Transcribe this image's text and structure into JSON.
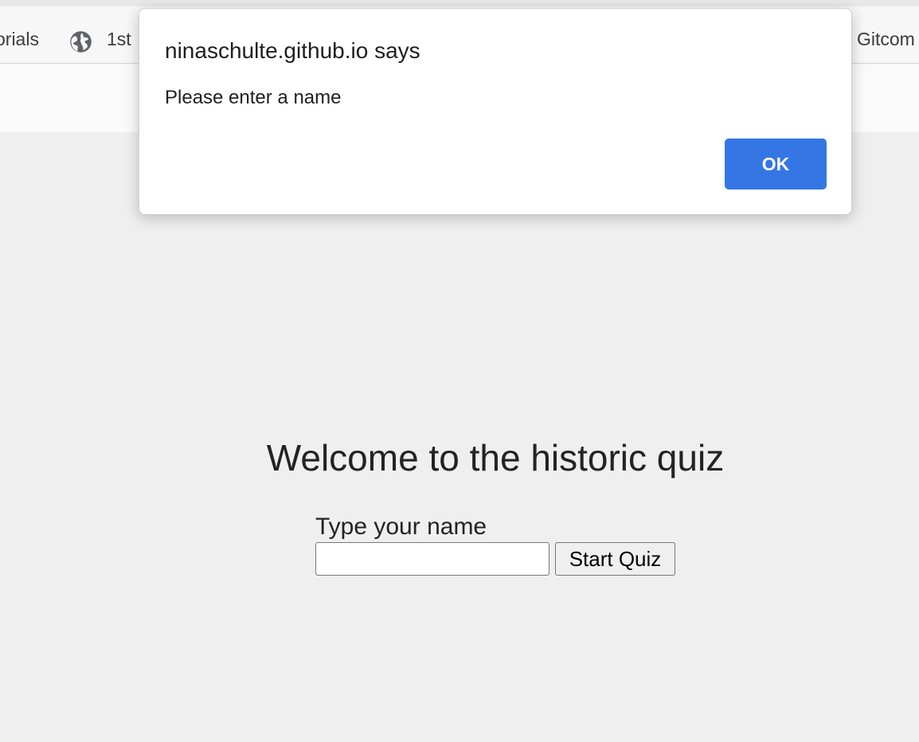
{
  "bookmarks_bar": {
    "items": [
      {
        "label": "orials"
      },
      {
        "label": "1st",
        "icon": "globe-icon"
      },
      {
        "label": "Gitcom"
      }
    ]
  },
  "dialog": {
    "title": "ninaschulte.github.io says",
    "message": "Please enter a name",
    "ok_label": "OK",
    "ok_color": "#3477e4"
  },
  "page": {
    "title": "Welcome to the historic quiz",
    "name_label": "Type your name",
    "name_value": "",
    "start_button_label": "Start Quiz",
    "background": "#efefef"
  }
}
